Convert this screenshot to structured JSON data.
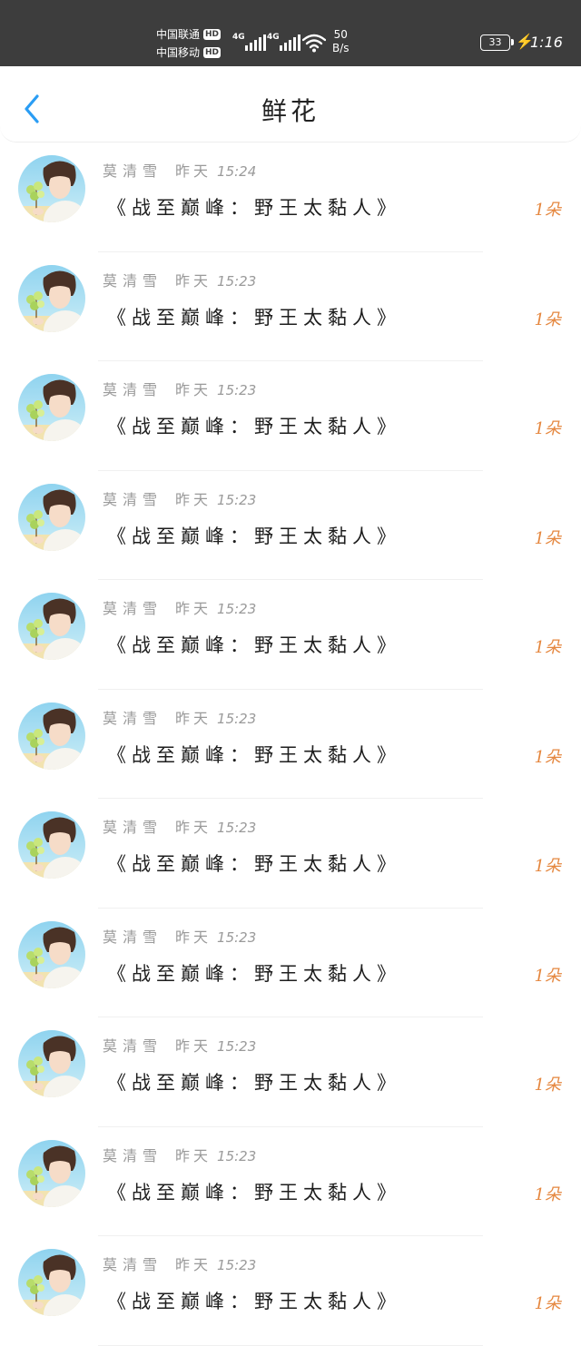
{
  "status_bar": {
    "carrier1": "中国联通",
    "carrier2": "中国移动",
    "hd": "HD",
    "signal1": "4G",
    "signal2": "4G",
    "speed_value": "50",
    "speed_unit": "B/s",
    "battery": "33",
    "time": "1:16"
  },
  "header": {
    "title": "鲜花"
  },
  "list": {
    "items": [
      {
        "name": "莫清雪",
        "day": "昨天",
        "time": "15:24",
        "book": "《战至巅峰：野王太黏人》",
        "count": "1朵"
      },
      {
        "name": "莫清雪",
        "day": "昨天",
        "time": "15:23",
        "book": "《战至巅峰：野王太黏人》",
        "count": "1朵"
      },
      {
        "name": "莫清雪",
        "day": "昨天",
        "time": "15:23",
        "book": "《战至巅峰：野王太黏人》",
        "count": "1朵"
      },
      {
        "name": "莫清雪",
        "day": "昨天",
        "time": "15:23",
        "book": "《战至巅峰：野王太黏人》",
        "count": "1朵"
      },
      {
        "name": "莫清雪",
        "day": "昨天",
        "time": "15:23",
        "book": "《战至巅峰：野王太黏人》",
        "count": "1朵"
      },
      {
        "name": "莫清雪",
        "day": "昨天",
        "time": "15:23",
        "book": "《战至巅峰：野王太黏人》",
        "count": "1朵"
      },
      {
        "name": "莫清雪",
        "day": "昨天",
        "time": "15:23",
        "book": "《战至巅峰：野王太黏人》",
        "count": "1朵"
      },
      {
        "name": "莫清雪",
        "day": "昨天",
        "time": "15:23",
        "book": "《战至巅峰：野王太黏人》",
        "count": "1朵"
      },
      {
        "name": "莫清雪",
        "day": "昨天",
        "time": "15:23",
        "book": "《战至巅峰：野王太黏人》",
        "count": "1朵"
      },
      {
        "name": "莫清雪",
        "day": "昨天",
        "time": "15:23",
        "book": "《战至巅峰：野王太黏人》",
        "count": "1朵"
      },
      {
        "name": "莫清雪",
        "day": "昨天",
        "time": "15:23",
        "book": "《战至巅峰：野王太黏人》",
        "count": "1朵"
      }
    ]
  },
  "colors": {
    "accent_blue": "#2a9df4",
    "count_orange": "#e5873f",
    "status_bar_bg": "#3d3d3d"
  },
  "icons": {
    "back": "chevron-left-icon",
    "avatar": "avatar-illustration"
  }
}
